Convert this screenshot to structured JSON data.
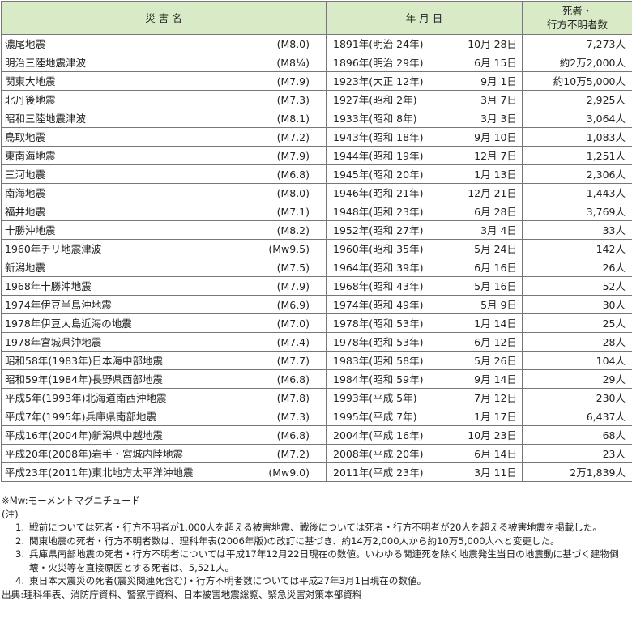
{
  "headers": {
    "name": "災 害 名",
    "date": "年 月 日",
    "toll_line1": "死者・",
    "toll_line2": "行方不明者数"
  },
  "rows": [
    {
      "name": "濃尾地震",
      "mag": "(M8.0)",
      "year": "1891年(明治 24年)",
      "md": "10月 28日",
      "toll": "7,273人"
    },
    {
      "name": "明治三陸地震津波",
      "mag": "(M8¼)",
      "year": "1896年(明治 29年)",
      "md": "6月 15日",
      "toll": "約2万2,000人"
    },
    {
      "name": "関東大地震",
      "mag": "(M7.9)",
      "year": "1923年(大正 12年)",
      "md": "9月 1日",
      "toll": "約10万5,000人"
    },
    {
      "name": "北丹後地震",
      "mag": "(M7.3)",
      "year": "1927年(昭和 2年)",
      "md": "3月 7日",
      "toll": "2,925人"
    },
    {
      "name": "昭和三陸地震津波",
      "mag": "(M8.1)",
      "year": "1933年(昭和 8年)",
      "md": "3月 3日",
      "toll": "3,064人"
    },
    {
      "name": "鳥取地震",
      "mag": "(M7.2)",
      "year": "1943年(昭和 18年)",
      "md": "9月 10日",
      "toll": "1,083人"
    },
    {
      "name": "東南海地震",
      "mag": "(M7.9)",
      "year": "1944年(昭和 19年)",
      "md": "12月 7日",
      "toll": "1,251人"
    },
    {
      "name": "三河地震",
      "mag": "(M6.8)",
      "year": "1945年(昭和 20年)",
      "md": "1月 13日",
      "toll": "2,306人"
    },
    {
      "name": "南海地震",
      "mag": "(M8.0)",
      "year": "1946年(昭和 21年)",
      "md": "12月 21日",
      "toll": "1,443人"
    },
    {
      "name": "福井地震",
      "mag": "(M7.1)",
      "year": "1948年(昭和 23年)",
      "md": "6月 28日",
      "toll": "3,769人"
    },
    {
      "name": "十勝沖地震",
      "mag": "(M8.2)",
      "year": "1952年(昭和 27年)",
      "md": "3月 4日",
      "toll": "33人"
    },
    {
      "name": "1960年チリ地震津波",
      "mag": "(Mw9.5)",
      "year": "1960年(昭和 35年)",
      "md": "5月 24日",
      "toll": "142人"
    },
    {
      "name": "新潟地震",
      "mag": "(M7.5)",
      "year": "1964年(昭和 39年)",
      "md": "6月 16日",
      "toll": "26人"
    },
    {
      "name": "1968年十勝沖地震",
      "mag": "(M7.9)",
      "year": "1968年(昭和 43年)",
      "md": "5月 16日",
      "toll": "52人"
    },
    {
      "name": "1974年伊豆半島沖地震",
      "mag": "(M6.9)",
      "year": "1974年(昭和 49年)",
      "md": "5月 9日",
      "toll": "30人"
    },
    {
      "name": "1978年伊豆大島近海の地震",
      "mag": "(M7.0)",
      "year": "1978年(昭和 53年)",
      "md": "1月 14日",
      "toll": "25人"
    },
    {
      "name": "1978年宮城県沖地震",
      "mag": "(M7.4)",
      "year": "1978年(昭和 53年)",
      "md": "6月 12日",
      "toll": "28人"
    },
    {
      "name": "昭和58年(1983年)日本海中部地震",
      "mag": "(M7.7)",
      "year": "1983年(昭和 58年)",
      "md": "5月 26日",
      "toll": "104人"
    },
    {
      "name": "昭和59年(1984年)長野県西部地震",
      "mag": "(M6.8)",
      "year": "1984年(昭和 59年)",
      "md": "9月 14日",
      "toll": "29人"
    },
    {
      "name": "平成5年(1993年)北海道南西沖地震",
      "mag": "(M7.8)",
      "year": "1993年(平成 5年)",
      "md": "7月 12日",
      "toll": "230人"
    },
    {
      "name": "平成7年(1995年)兵庫県南部地震",
      "mag": "(M7.3)",
      "year": "1995年(平成 7年)",
      "md": "1月 17日",
      "toll": "6,437人"
    },
    {
      "name": "平成16年(2004年)新潟県中越地震",
      "mag": "(M6.8)",
      "year": "2004年(平成 16年)",
      "md": "10月 23日",
      "toll": "68人"
    },
    {
      "name": "平成20年(2008年)岩手・宮城内陸地震",
      "mag": "(M7.2)",
      "year": "2008年(平成 20年)",
      "md": "6月 14日",
      "toll": "23人"
    },
    {
      "name": "平成23年(2011年)東北地方太平洋沖地震",
      "mag": "(Mw9.0)",
      "year": "2011年(平成 23年)",
      "md": "3月 11日",
      "toll": "2万1,839人"
    }
  ],
  "footnote_mw": "※Mw:モーメントマグニチュード",
  "notes_label": "(注)",
  "notes": [
    {
      "num": "1.",
      "text": "戦前については死者・行方不明者が1,000人を超える被害地震、戦後については死者・行方不明者が20人を超える被害地震を掲載した。"
    },
    {
      "num": "2.",
      "text": "関東地震の死者・行方不明者数は、理科年表(2006年版)の改訂に基づき、約14万2,000人から約10万5,000人へと変更した。"
    },
    {
      "num": "3.",
      "text": "兵庫県南部地震の死者・行方不明者については平成17年12月22日現在の数値。いわゆる関連死を除く地震発生当日の地震動に基づく建物倒壊・火災等を直接原因とする死者は、5,521人。"
    },
    {
      "num": "4.",
      "text": "東日本大震災の死者(震災関連死含む)・行方不明者数については平成27年3月1日現在の数値。"
    }
  ],
  "source": "出典:理科年表、消防庁資料、警察庁資料、日本被害地震総覧、緊急災害対策本部資料",
  "colors": {
    "header_bg": "#d8ebc6",
    "border": "#777777"
  }
}
